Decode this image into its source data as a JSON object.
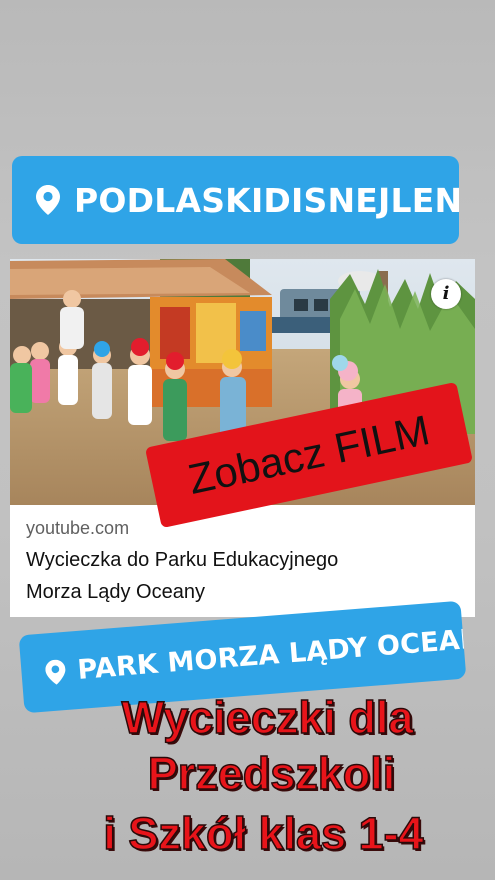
{
  "colors": {
    "location_sticker": "#2fa4e7",
    "film_sticker": "#e3141b",
    "promo_text": "#e8141a"
  },
  "sticker_top": {
    "icon": "location-pin-icon",
    "label": "PODLASKIDISNEJLEND"
  },
  "video_card": {
    "info_icon": "i",
    "domain": "youtube.com",
    "title_line_1": "Wycieczka do Parku Edukacyjnego",
    "title_line_2": "Morza Lądy Oceany"
  },
  "film_sticker": {
    "label": "Zobacz FILM"
  },
  "sticker_bottom": {
    "icon": "location-pin-icon",
    "label": "PARK MORZA LĄDY OCEANY"
  },
  "promo": {
    "line_1": "Wycieczki dla",
    "line_2": "Przedszkoli",
    "line_3": "i Szkół klas 1-4"
  }
}
